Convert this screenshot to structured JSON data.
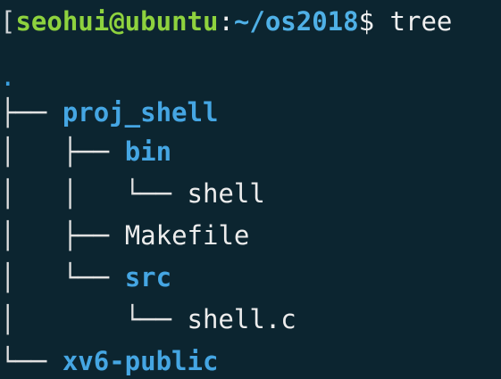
{
  "prompt": {
    "bracket": "[",
    "user_host": "seohui@ubuntu",
    "separator": ":",
    "cwd": "~/os2018",
    "symbol": "$",
    "command": "tree"
  },
  "tree": {
    "root": ".",
    "lines": [
      {
        "guides": "├── ",
        "name": "proj_shell"
      },
      {
        "guides": "│   ├── ",
        "name": "bin"
      },
      {
        "guides": "│   │   └── ",
        "name": "shell"
      },
      {
        "guides": "│   ├── ",
        "name": "Makefile"
      },
      {
        "guides": "│   └── ",
        "name": "src"
      },
      {
        "guides": "│       └── ",
        "name": "shell.c"
      },
      {
        "guides": "└── ",
        "name": "xv6-public"
      }
    ]
  },
  "colors": {
    "background": "#0c2530",
    "user_host": "#8ed23e",
    "path": "#4fb0e6",
    "directory": "#45a6e3",
    "file": "#ececec"
  }
}
